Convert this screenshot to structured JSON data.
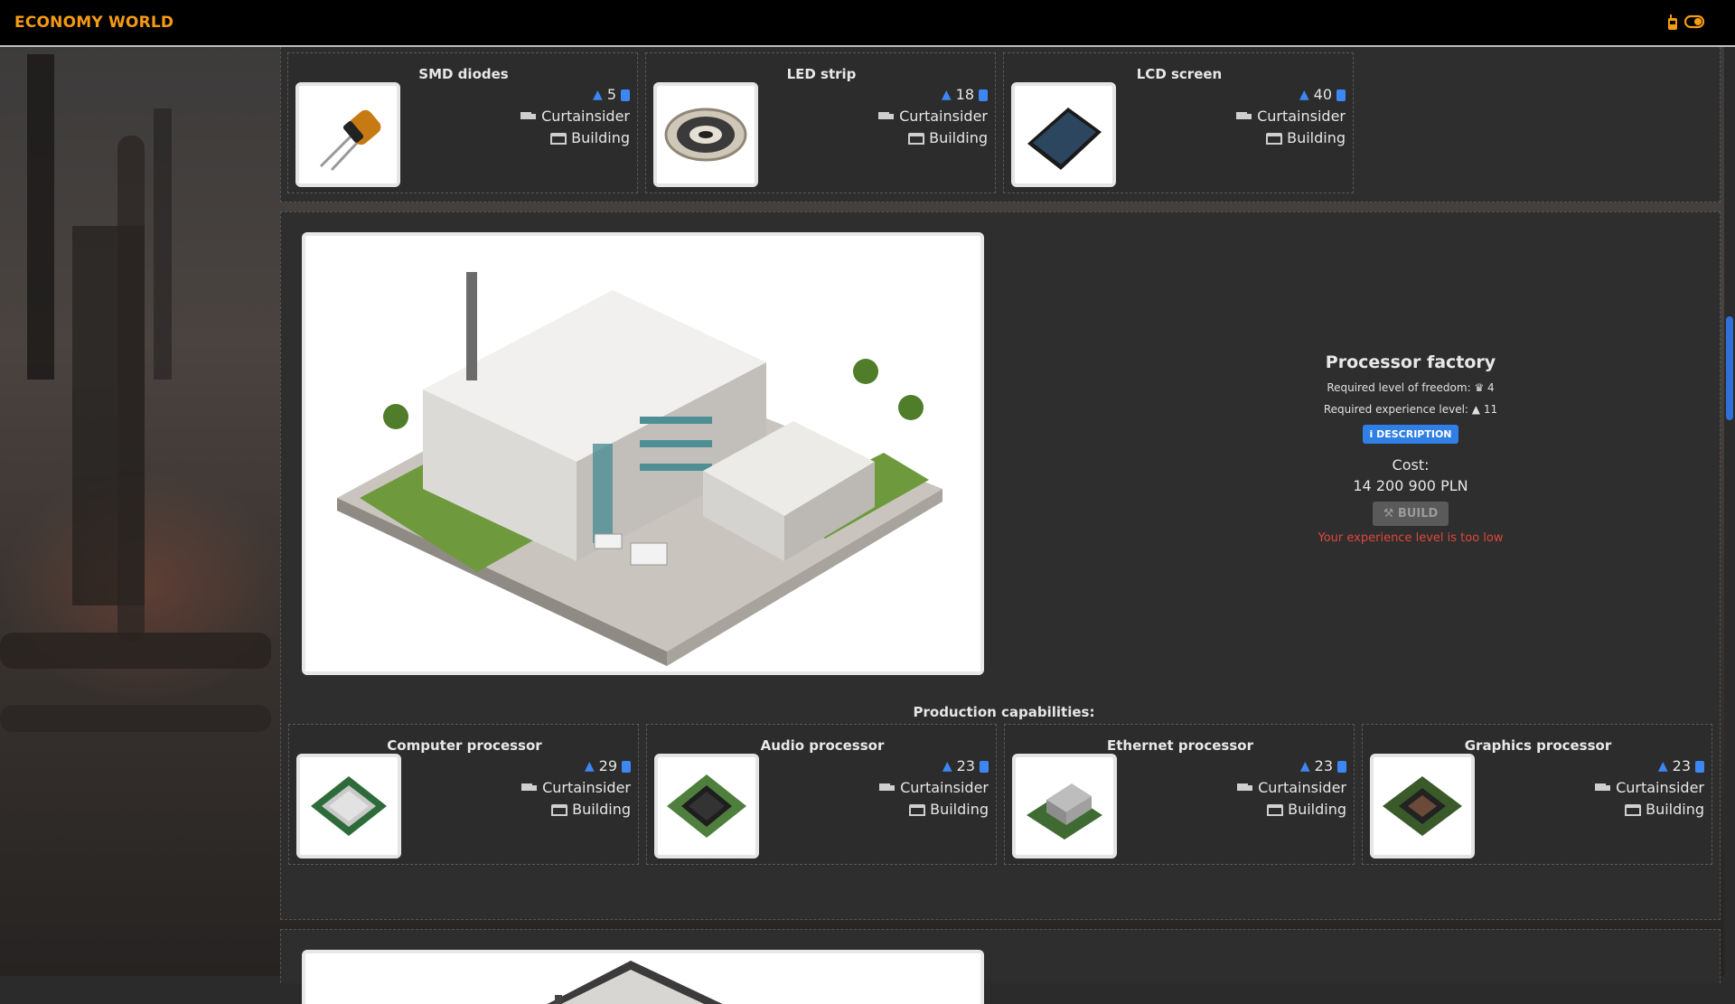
{
  "header": {
    "brand": "ECONOMY WORLD",
    "icons": [
      "walkie-talkie-icon",
      "toggle-icon"
    ]
  },
  "top_products": [
    {
      "name": "SMD diodes",
      "level": "5",
      "transport": "Curtainsider",
      "location": "Building",
      "image": "smd-diode-image"
    },
    {
      "name": "LED strip",
      "level": "18",
      "transport": "Curtainsider",
      "location": "Building",
      "image": "led-strip-image"
    },
    {
      "name": "LCD screen",
      "level": "40",
      "transport": "Curtainsider",
      "location": "Building",
      "image": "lcd-screen-image"
    }
  ],
  "factory": {
    "name": "Processor factory",
    "freedom_label": "Required level of freedom:",
    "freedom_value": "4",
    "experience_label": "Required experience level:",
    "experience_value": "11",
    "description_button": "DESCRIPTION",
    "cost_label": "Cost:",
    "cost_value": "14 200 900  PLN",
    "build_button": "BUILD",
    "warning": "Your experience level is too low"
  },
  "production": {
    "title": "Production capabilities:",
    "items": [
      {
        "name": "Computer processor",
        "level": "29",
        "transport": "Curtainsider",
        "location": "Building",
        "image": "cpu-image"
      },
      {
        "name": "Audio processor",
        "level": "23",
        "transport": "Curtainsider",
        "location": "Building",
        "image": "audio-chip-image"
      },
      {
        "name": "Ethernet processor",
        "level": "23",
        "transport": "Curtainsider",
        "location": "Building",
        "image": "ethernet-chip-image"
      },
      {
        "name": "Graphics processor",
        "level": "23",
        "transport": "Curtainsider",
        "location": "Building",
        "image": "gpu-chip-image"
      }
    ]
  },
  "colors": {
    "brand": "#f59b12",
    "accent_blue": "#2f7fe6",
    "warning": "#e0473a",
    "header_bg": "#000000"
  }
}
